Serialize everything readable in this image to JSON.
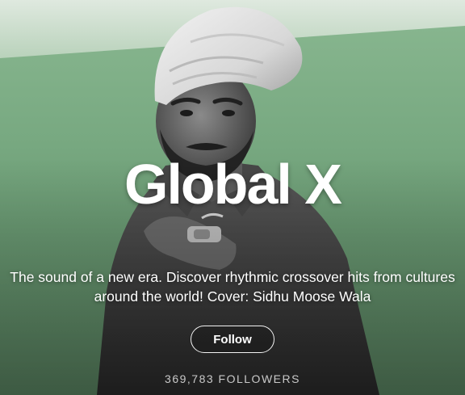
{
  "playlist": {
    "title": "Global X",
    "description": "The sound of a new era. Discover rhythmic crossover hits from cultures around the world! Cover: Sidhu Moose Wala",
    "follow_label": "Follow",
    "followers": "369,783 FOLLOWERS"
  },
  "colors": {
    "accent_green": "#7fb187",
    "text": "#ffffff",
    "muted_text": "#c9c9c9"
  },
  "icons": {
    "cover_art": "cover-photo"
  }
}
